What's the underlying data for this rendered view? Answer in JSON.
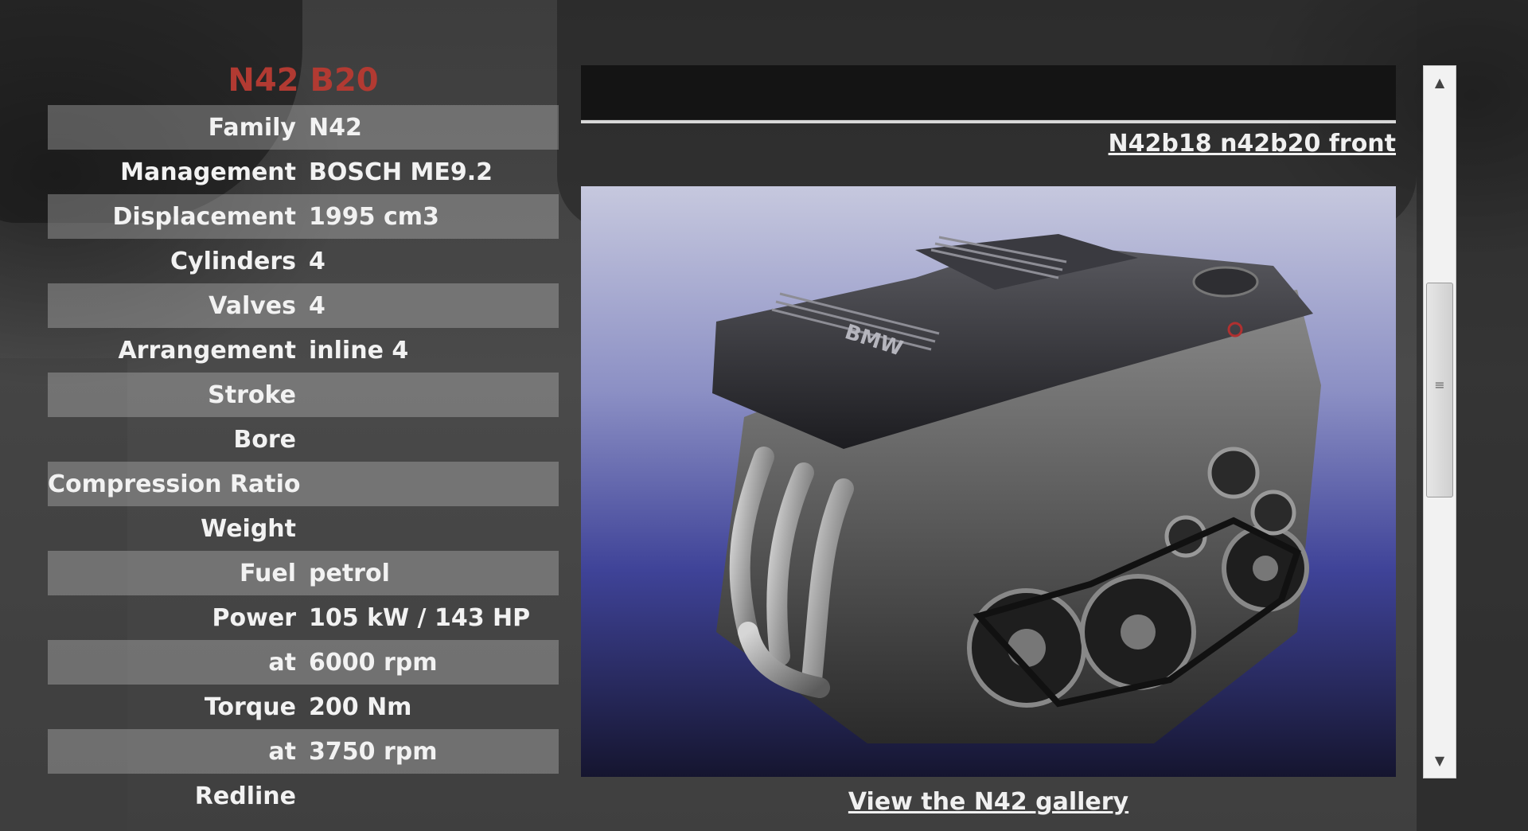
{
  "engine": {
    "title": "N42 B20"
  },
  "specs": [
    {
      "label": "Family",
      "value": "N42"
    },
    {
      "label": "Management",
      "value": "BOSCH ME9.2"
    },
    {
      "label": "Displacement",
      "value": "1995 cm3"
    },
    {
      "label": "Cylinders",
      "value": "4"
    },
    {
      "label": "Valves",
      "value": "4"
    },
    {
      "label": "Arrangement",
      "value": "inline 4"
    },
    {
      "label": "Stroke",
      "value": ""
    },
    {
      "label": "Bore",
      "value": ""
    },
    {
      "label": "Compression Ratio",
      "value": ""
    },
    {
      "label": "Weight",
      "value": ""
    },
    {
      "label": "Fuel",
      "value": "petrol"
    },
    {
      "label": "Power",
      "value": "105 kW / 143 HP"
    },
    {
      "label": "at",
      "value": "6000 rpm"
    },
    {
      "label": "Torque",
      "value": "200 Nm"
    },
    {
      "label": "at",
      "value": "3750 rpm"
    },
    {
      "label": "Redline",
      "value": ""
    }
  ],
  "gallery": {
    "caption_link": "N42b18 n42b20 front",
    "view_link": "View the N42 gallery"
  },
  "photo": {
    "logo_text": "BMW"
  },
  "icons": {
    "scroll_up": "scroll-up-arrow",
    "scroll_down": "scroll-down-arrow"
  }
}
